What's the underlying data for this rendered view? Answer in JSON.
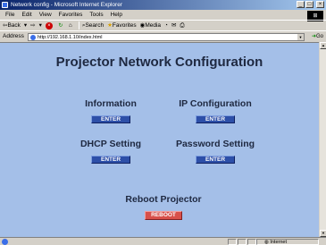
{
  "window": {
    "title": "Network config - Microsoft Internet Explorer",
    "minimize": "_",
    "maximize": "□",
    "close": "×"
  },
  "menu": [
    "File",
    "Edit",
    "View",
    "Favorites",
    "Tools",
    "Help"
  ],
  "toolbar": {
    "back": "Back",
    "search": "Search",
    "favorites": "Favorites",
    "media": "Media"
  },
  "address": {
    "label": "Address",
    "url": "http://192.168.1.10/index.html",
    "go": "Go"
  },
  "page": {
    "title": "Projector Network Configuration",
    "sections": {
      "information": {
        "label": "Information",
        "button": "ENTER"
      },
      "ip_configuration": {
        "label": "IP Configuration",
        "button": "ENTER"
      },
      "dhcp_setting": {
        "label": "DHCP Setting",
        "button": "ENTER"
      },
      "password_setting": {
        "label": "Password Setting",
        "button": "ENTER"
      },
      "reboot": {
        "label": "Reboot Projector",
        "button": "REBOOT"
      }
    }
  },
  "status": {
    "zone": "Internet"
  }
}
